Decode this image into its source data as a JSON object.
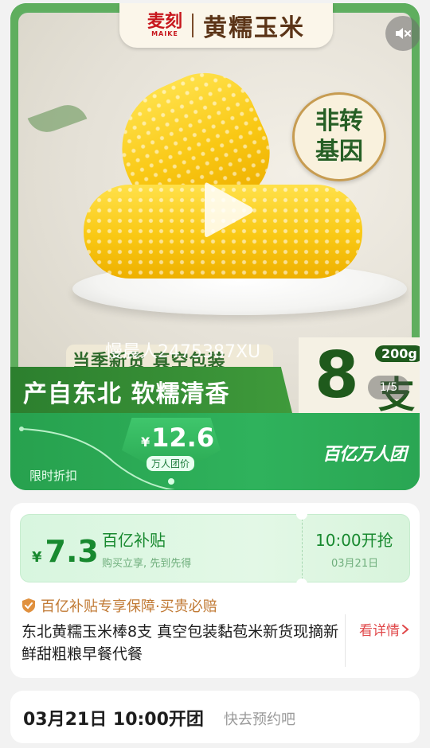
{
  "hero": {
    "brand_logo_cn": "麦刻",
    "brand_logo_en": "MAIKE",
    "brand_title": "黄糯玉米",
    "badge_line1": "非转",
    "badge_line2": "基因",
    "sub_slogan": "当季新货 真空包装",
    "main_slogan": "产自东北 软糯清香",
    "watermark": "慢晨人2475387XU",
    "quantity": "8",
    "quantity_unit": "支",
    "weight": "200g",
    "page_indicator": "1/5",
    "icons": {
      "mute": "mute-icon",
      "play": "play-icon"
    }
  },
  "price_bar": {
    "flash_label": "限时折扣",
    "currency": "¥",
    "price": "12.6",
    "price_caption": "万人团价",
    "brand_group": "百亿万人团"
  },
  "subsidy": {
    "currency": "¥",
    "price": "7.3",
    "title": "百亿补贴",
    "desc": "购买立享, 先到先得",
    "time": "10:00开抢",
    "date": "03月21日",
    "guarantee": "百亿补贴专享保障·买贵必赔",
    "product_title": "东北黄糯玉米棒8支 真空包装黏苞米新货现摘新鲜甜粗粮早餐代餐",
    "detail_link": "看详情"
  },
  "open_bar": {
    "main": "03月21日 10:00开团",
    "sub": "快去预约吧"
  },
  "colors": {
    "accent_green": "#2fb25c",
    "dark_green": "#1f5a1c",
    "subsidy_green": "#18892f",
    "guarantee_orange": "#c17a35",
    "link_red": "#e0484a"
  }
}
